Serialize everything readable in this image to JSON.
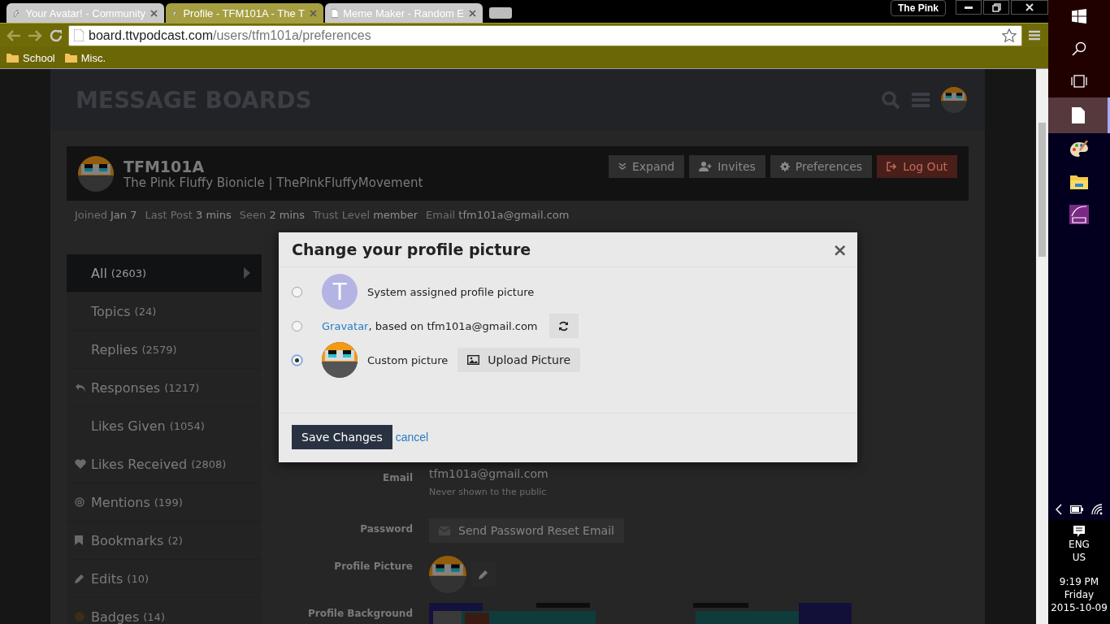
{
  "browser": {
    "tabs": [
      {
        "title": "Your Avatar! - Community",
        "selected": false
      },
      {
        "title": "Profile - TFM101A - The T",
        "selected": true
      },
      {
        "title": "Meme Maker - Random E",
        "selected": false
      }
    ],
    "profile_name": "The Pink",
    "address": {
      "host": "board.ttvpodcast.com",
      "path": "/users/tfm101a/preferences"
    },
    "bookmarks": [
      "School",
      "Misc."
    ]
  },
  "site": {
    "title": "MESSAGE BOARDS"
  },
  "profile": {
    "username": "TFM101A",
    "title": "The Pink Fluffy Bionicle | ThePinkFluffyMovement",
    "buttons": [
      {
        "label": "Expand",
        "kind": "normal"
      },
      {
        "label": "Invites",
        "kind": "normal"
      },
      {
        "label": "Preferences",
        "kind": "normal"
      },
      {
        "label": "Log Out",
        "kind": "danger"
      }
    ],
    "stats": [
      {
        "label": "Joined",
        "value": "Jan 7"
      },
      {
        "label": "Last Post",
        "value": "3 mins"
      },
      {
        "label": "Seen",
        "value": "2 mins"
      },
      {
        "label": "Trust Level",
        "value": "member"
      },
      {
        "label": "Email",
        "value": "tfm101a@gmail.com"
      }
    ]
  },
  "sidebar": {
    "items": [
      {
        "label": "All",
        "count": "(2603)",
        "selected": true
      },
      {
        "label": "Topics",
        "count": "(24)",
        "selected": false
      },
      {
        "label": "Replies",
        "count": "(2579)",
        "selected": false
      },
      {
        "label": "Responses",
        "count": "(1217)",
        "selected": false
      },
      {
        "label": "Likes Given",
        "count": "(1054)",
        "selected": false
      },
      {
        "label": "Likes Received",
        "count": "(2808)",
        "selected": false
      },
      {
        "label": "Mentions",
        "count": "(199)",
        "selected": false
      },
      {
        "label": "Bookmarks",
        "count": "(2)",
        "selected": false
      },
      {
        "label": "Edits",
        "count": "(10)",
        "selected": false
      },
      {
        "label": "Badges",
        "count": "(14)",
        "selected": false
      }
    ]
  },
  "form": {
    "email": {
      "label": "Email",
      "value": "tfm101a@gmail.com",
      "hint": "Never shown to the public"
    },
    "password": {
      "label": "Password",
      "button": "Send Password Reset Email"
    },
    "profile_picture": {
      "label": "Profile Picture"
    },
    "profile_background": {
      "label": "Profile Background",
      "kind": "picture"
    }
  },
  "dialog": {
    "title": "Change your profile picture",
    "close": "×",
    "options": [
      {
        "kind": "letter",
        "letter": "T",
        "text": "System assigned profile picture",
        "selected": false
      },
      {
        "kind": "gravatar",
        "link": "Gravatar",
        "text": ", based on tfm101a@gmail.com",
        "selected": false
      },
      {
        "kind": "custom",
        "text": "Custom picture",
        "button": "Upload Picture",
        "selected": true
      }
    ],
    "save": "Save Changes",
    "cancel": "cancel"
  },
  "taskbar": {
    "apps": [
      {
        "selected": true
      },
      {
        "selected": false
      },
      {
        "selected": false
      },
      {
        "selected": false
      }
    ],
    "language": "ENG",
    "region": "US",
    "time": "9:19 PM",
    "day": "Friday",
    "date": "2015-10-09"
  }
}
